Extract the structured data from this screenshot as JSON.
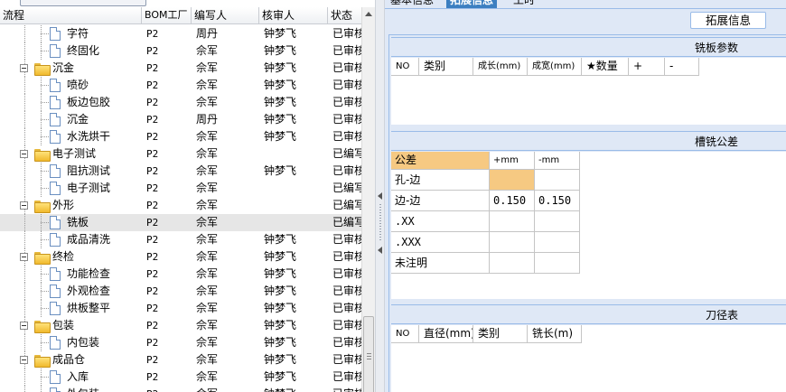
{
  "tree": {
    "columns": [
      "流程",
      "BOM工厂",
      "编写人",
      "核审人",
      "状态"
    ],
    "rows": [
      {
        "level": 2,
        "type": "item",
        "name": "字符",
        "factory": "P2",
        "editor": "周丹",
        "reviewer": "钟梦飞",
        "status": "已审核"
      },
      {
        "level": 2,
        "type": "item",
        "name": "终固化",
        "factory": "P2",
        "editor": "佘军",
        "reviewer": "钟梦飞",
        "status": "已审核"
      },
      {
        "level": 1,
        "type": "group",
        "name": "沉金",
        "factory": "P2",
        "editor": "佘军",
        "reviewer": "钟梦飞",
        "status": "已审核"
      },
      {
        "level": 2,
        "type": "item",
        "name": "喷砂",
        "factory": "P2",
        "editor": "佘军",
        "reviewer": "钟梦飞",
        "status": "已审核"
      },
      {
        "level": 2,
        "type": "item",
        "name": "板边包胶",
        "factory": "P2",
        "editor": "佘军",
        "reviewer": "钟梦飞",
        "status": "已审核"
      },
      {
        "level": 2,
        "type": "item",
        "name": "沉金",
        "factory": "P2",
        "editor": "周丹",
        "reviewer": "钟梦飞",
        "status": "已审核"
      },
      {
        "level": 2,
        "type": "item",
        "name": "水洗烘干",
        "factory": "P2",
        "editor": "佘军",
        "reviewer": "钟梦飞",
        "status": "已审核"
      },
      {
        "level": 1,
        "type": "group",
        "name": "电子测试",
        "factory": "P2",
        "editor": "佘军",
        "reviewer": "",
        "status": "已编写"
      },
      {
        "level": 2,
        "type": "item",
        "name": "阻抗测试",
        "factory": "P2",
        "editor": "佘军",
        "reviewer": "钟梦飞",
        "status": "已审核"
      },
      {
        "level": 2,
        "type": "item",
        "name": "电子测试",
        "factory": "P2",
        "editor": "佘军",
        "reviewer": "",
        "status": "已编写"
      },
      {
        "level": 1,
        "type": "group",
        "name": "外形",
        "factory": "P2",
        "editor": "佘军",
        "reviewer": "",
        "status": "已编写"
      },
      {
        "level": 2,
        "type": "item",
        "name": "铣板",
        "factory": "P2",
        "editor": "佘军",
        "reviewer": "",
        "status": "已编写",
        "selected": true
      },
      {
        "level": 2,
        "type": "item",
        "name": "成品清洗",
        "factory": "P2",
        "editor": "佘军",
        "reviewer": "钟梦飞",
        "status": "已审核"
      },
      {
        "level": 1,
        "type": "group",
        "name": "终检",
        "factory": "P2",
        "editor": "佘军",
        "reviewer": "钟梦飞",
        "status": "已审核"
      },
      {
        "level": 2,
        "type": "item",
        "name": "功能检查",
        "factory": "P2",
        "editor": "佘军",
        "reviewer": "钟梦飞",
        "status": "已审核"
      },
      {
        "level": 2,
        "type": "item",
        "name": "外观检查",
        "factory": "P2",
        "editor": "佘军",
        "reviewer": "钟梦飞",
        "status": "已审核"
      },
      {
        "level": 2,
        "type": "item",
        "name": "烘板整平",
        "factory": "P2",
        "editor": "佘军",
        "reviewer": "钟梦飞",
        "status": "已审核"
      },
      {
        "level": 1,
        "type": "group",
        "name": "包装",
        "factory": "P2",
        "editor": "佘军",
        "reviewer": "钟梦飞",
        "status": "已审核"
      },
      {
        "level": 2,
        "type": "item",
        "name": "内包装",
        "factory": "P2",
        "editor": "佘军",
        "reviewer": "钟梦飞",
        "status": "已审核"
      },
      {
        "level": 1,
        "type": "group",
        "name": "成品仓",
        "factory": "P2",
        "editor": "佘军",
        "reviewer": "钟梦飞",
        "status": "已审核"
      },
      {
        "level": 2,
        "type": "item",
        "name": "入库",
        "factory": "P2",
        "editor": "佘军",
        "reviewer": "钟梦飞",
        "status": "已审核"
      },
      {
        "level": 2,
        "type": "item",
        "name": "外包装",
        "factory": "P2",
        "editor": "佘军",
        "reviewer": "钟梦飞",
        "status": "已审核"
      }
    ]
  },
  "tabs": [
    {
      "label": "基本信息",
      "active": false
    },
    {
      "label": "拓展信息",
      "active": true
    },
    {
      "label": "工时",
      "active": false
    }
  ],
  "extension": {
    "title_button": "拓展信息",
    "milling_params": {
      "title": "铣板参数",
      "columns": [
        "NO",
        "类别",
        "成长(mm)",
        "成宽(mm)",
        "★数量",
        "+",
        "-"
      ]
    },
    "slot_tolerance": {
      "title": "槽铣公差",
      "header": [
        "公差",
        "+mm",
        "-mm"
      ],
      "rows": [
        {
          "label": "孔-边",
          "plus": "",
          "minus": ""
        },
        {
          "label": "边-边",
          "plus": "0.150",
          "minus": "0.150"
        },
        {
          "label": ".XX",
          "plus": "",
          "minus": ""
        },
        {
          "label": ".XXX",
          "plus": "",
          "minus": ""
        },
        {
          "label": "未注明",
          "plus": "",
          "minus": ""
        }
      ]
    },
    "tool_table": {
      "title": "刀径表",
      "columns": [
        "NO",
        "直径(mm)",
        "类别",
        "铣长(m)"
      ]
    }
  },
  "colors": {
    "panel_bg": "#dfe8f6",
    "panel_border": "#99bbe8",
    "tab_active": "#3c7fc1",
    "tolerance_highlight": "#f6c982",
    "selected_row": "#e6e6e6",
    "folder": "#f0b92d"
  }
}
